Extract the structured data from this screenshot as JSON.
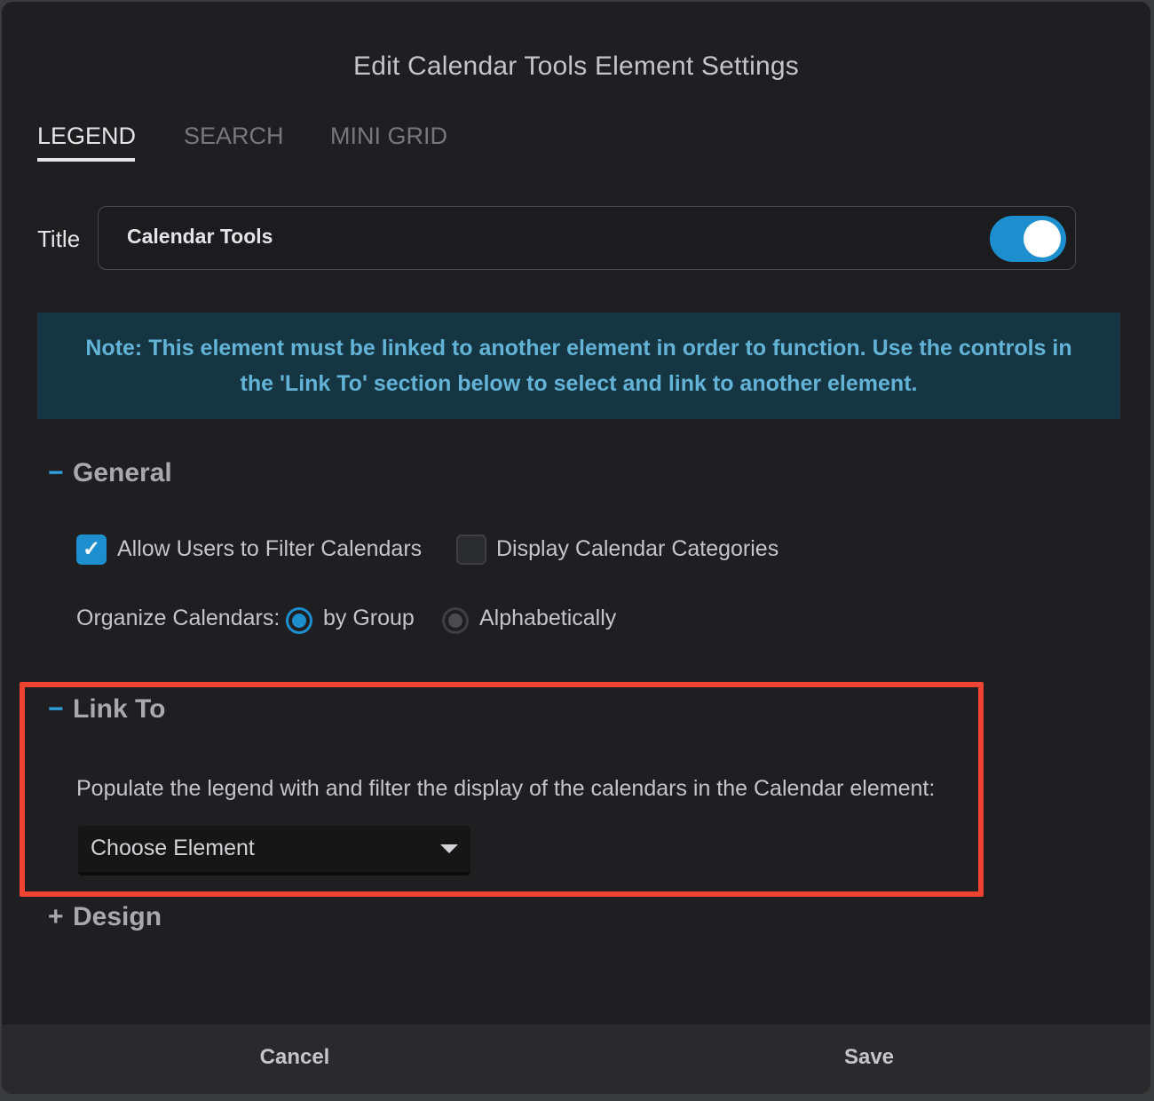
{
  "dialog": {
    "title": "Edit Calendar Tools Element Settings"
  },
  "tabs": [
    {
      "label": "LEGEND",
      "active": true
    },
    {
      "label": "SEARCH",
      "active": false
    },
    {
      "label": "MINI GRID",
      "active": false
    }
  ],
  "title_field": {
    "label": "Title",
    "value": "Calendar Tools",
    "toggle_on": true
  },
  "note": {
    "text": "Note: This element must be linked to another element in order to function. Use the controls in the 'Link To' section below to select and link to another element."
  },
  "sections": {
    "general": {
      "symbol": "−",
      "label": "General",
      "expanded": true,
      "checkboxes": [
        {
          "label": "Allow Users to Filter Calendars",
          "checked": true,
          "mark": "✓"
        },
        {
          "label": "Display Calendar Categories",
          "checked": false
        }
      ],
      "organize": {
        "label": "Organize Calendars:",
        "options": [
          {
            "label": "by Group",
            "selected": true
          },
          {
            "label": "Alphabetically",
            "selected": false
          }
        ]
      }
    },
    "link_to": {
      "symbol": "−",
      "label": "Link To",
      "expanded": true,
      "description": "Populate the legend with and filter the display of the calendars in the Calendar element:",
      "select": {
        "value": "Choose Element"
      }
    },
    "design": {
      "symbol": "+",
      "label": "Design",
      "expanded": false
    }
  },
  "footer": {
    "cancel_label": "Cancel",
    "save_label": "Save"
  },
  "colors": {
    "accent": "#1d8fcf",
    "highlight": "#f04432",
    "note_bg": "#163543",
    "note_text": "#63b3d6"
  }
}
